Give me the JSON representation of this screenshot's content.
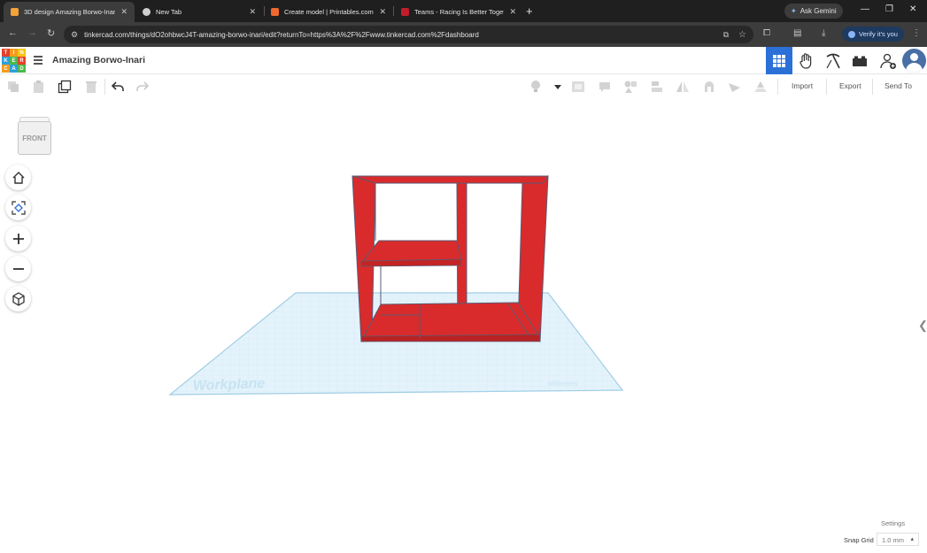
{
  "browser": {
    "tabs": [
      {
        "title": "3D design Amazing Borwo-Inar",
        "active": true,
        "favicon_color": "#f2a33a"
      },
      {
        "title": "New Tab",
        "active": false,
        "favicon_color": "#cfcfcf"
      },
      {
        "title": "Create model | Printables.com",
        "active": false,
        "favicon_color": "#f0692c"
      },
      {
        "title": "Teams - Racing Is Better Togeth",
        "active": false,
        "favicon_color": "#c21d2b"
      }
    ],
    "ask_gemini": "Ask Gemini",
    "url": "tinkercad.com/things/dO2ohbwcJ4T-amazing-borwo-inari/edit?returnTo=https%3A%2F%2Fwww.tinkercad.com%2Fdashboard",
    "verify": "Verify it's you"
  },
  "app": {
    "logo_letters": [
      "T",
      "I",
      "N",
      "K",
      "E",
      "R",
      "C",
      "A",
      "D"
    ],
    "design_title": "Amazing Borwo-Inari",
    "modes": [
      "3d-design-grid",
      "codeblocks-hand",
      "sim-pickaxe",
      "bricks"
    ],
    "toolbar": {
      "import_label": "Import",
      "export_label": "Export",
      "send_to_label": "Send To"
    }
  },
  "viewport": {
    "viewcube_label": "FRONT",
    "workplane_label": "Workplane",
    "units_label": "Millimeters",
    "settings_label": "Settings",
    "snap_grid_label": "Snap Grid",
    "snap_grid_value": "1.0 mm"
  },
  "colors": {
    "model_red": "#d92b2b",
    "workplane_fill": "#e4f3fb",
    "accent_blue": "#2a70d7"
  }
}
